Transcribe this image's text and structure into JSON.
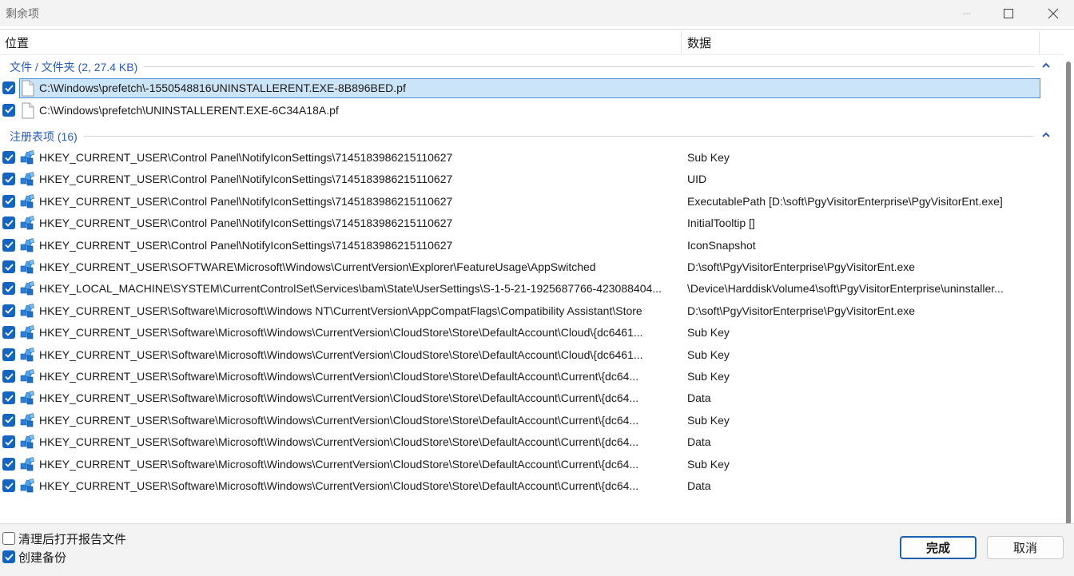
{
  "window": {
    "title": "剩余项"
  },
  "columns": {
    "location": "位置",
    "data": "数据"
  },
  "groups": {
    "files": {
      "label": "文件 / 文件夹 (2, 27.4 KB)",
      "rows": [
        {
          "path": "C:\\Windows\\prefetch\\-1550548816UNINSTALLERENT.EXE-8B896BED.pf",
          "data": ""
        },
        {
          "path": "C:\\Windows\\prefetch\\UNINSTALLERENT.EXE-6C34A18A.pf",
          "data": ""
        }
      ]
    },
    "registry": {
      "label": "注册表项 (16)",
      "rows": [
        {
          "path": "HKEY_CURRENT_USER\\Control Panel\\NotifyIconSettings\\7145183986215110627",
          "data": "Sub Key"
        },
        {
          "path": "HKEY_CURRENT_USER\\Control Panel\\NotifyIconSettings\\7145183986215110627",
          "data": "UID"
        },
        {
          "path": "HKEY_CURRENT_USER\\Control Panel\\NotifyIconSettings\\7145183986215110627",
          "data": "ExecutablePath [D:\\soft\\PgyVisitorEnterprise\\PgyVisitorEnt.exe]"
        },
        {
          "path": "HKEY_CURRENT_USER\\Control Panel\\NotifyIconSettings\\7145183986215110627",
          "data": "InitialTooltip []"
        },
        {
          "path": "HKEY_CURRENT_USER\\Control Panel\\NotifyIconSettings\\7145183986215110627",
          "data": "IconSnapshot"
        },
        {
          "path": "HKEY_CURRENT_USER\\SOFTWARE\\Microsoft\\Windows\\CurrentVersion\\Explorer\\FeatureUsage\\AppSwitched",
          "data": "D:\\soft\\PgyVisitorEnterprise\\PgyVisitorEnt.exe"
        },
        {
          "path": "HKEY_LOCAL_MACHINE\\SYSTEM\\CurrentControlSet\\Services\\bam\\State\\UserSettings\\S-1-5-21-1925687766-423088404...",
          "data": "\\Device\\HarddiskVolume4\\soft\\PgyVisitorEnterprise\\uninstaller..."
        },
        {
          "path": "HKEY_CURRENT_USER\\Software\\Microsoft\\Windows NT\\CurrentVersion\\AppCompatFlags\\Compatibility Assistant\\Store",
          "data": "D:\\soft\\PgyVisitorEnterprise\\PgyVisitorEnt.exe"
        },
        {
          "path": "HKEY_CURRENT_USER\\Software\\Microsoft\\Windows\\CurrentVersion\\CloudStore\\Store\\DefaultAccount\\Cloud\\{dc6461...",
          "data": "Sub Key"
        },
        {
          "path": "HKEY_CURRENT_USER\\Software\\Microsoft\\Windows\\CurrentVersion\\CloudStore\\Store\\DefaultAccount\\Cloud\\{dc6461...",
          "data": "Sub Key"
        },
        {
          "path": "HKEY_CURRENT_USER\\Software\\Microsoft\\Windows\\CurrentVersion\\CloudStore\\Store\\DefaultAccount\\Current\\{dc64...",
          "data": "Sub Key"
        },
        {
          "path": "HKEY_CURRENT_USER\\Software\\Microsoft\\Windows\\CurrentVersion\\CloudStore\\Store\\DefaultAccount\\Current\\{dc64...",
          "data": "Data"
        },
        {
          "path": "HKEY_CURRENT_USER\\Software\\Microsoft\\Windows\\CurrentVersion\\CloudStore\\Store\\DefaultAccount\\Current\\{dc64...",
          "data": "Sub Key"
        },
        {
          "path": "HKEY_CURRENT_USER\\Software\\Microsoft\\Windows\\CurrentVersion\\CloudStore\\Store\\DefaultAccount\\Current\\{dc64...",
          "data": "Data"
        },
        {
          "path": "HKEY_CURRENT_USER\\Software\\Microsoft\\Windows\\CurrentVersion\\CloudStore\\Store\\DefaultAccount\\Current\\{dc64...",
          "data": "Sub Key"
        },
        {
          "path": "HKEY_CURRENT_USER\\Software\\Microsoft\\Windows\\CurrentVersion\\CloudStore\\Store\\DefaultAccount\\Current\\{dc64...",
          "data": "Data"
        }
      ]
    }
  },
  "footer": {
    "open_report": {
      "label": "清理后打开报告文件",
      "checked": false
    },
    "create_backup": {
      "label": "创建备份",
      "checked": true
    },
    "done_label": "完成",
    "cancel_label": "取消"
  },
  "colors": {
    "accent": "#1565c0",
    "group_label": "#2a5db8",
    "selection": "#cce4f7"
  },
  "icons": {
    "file": "file-icon",
    "registry": "registry-cubes-icon"
  }
}
